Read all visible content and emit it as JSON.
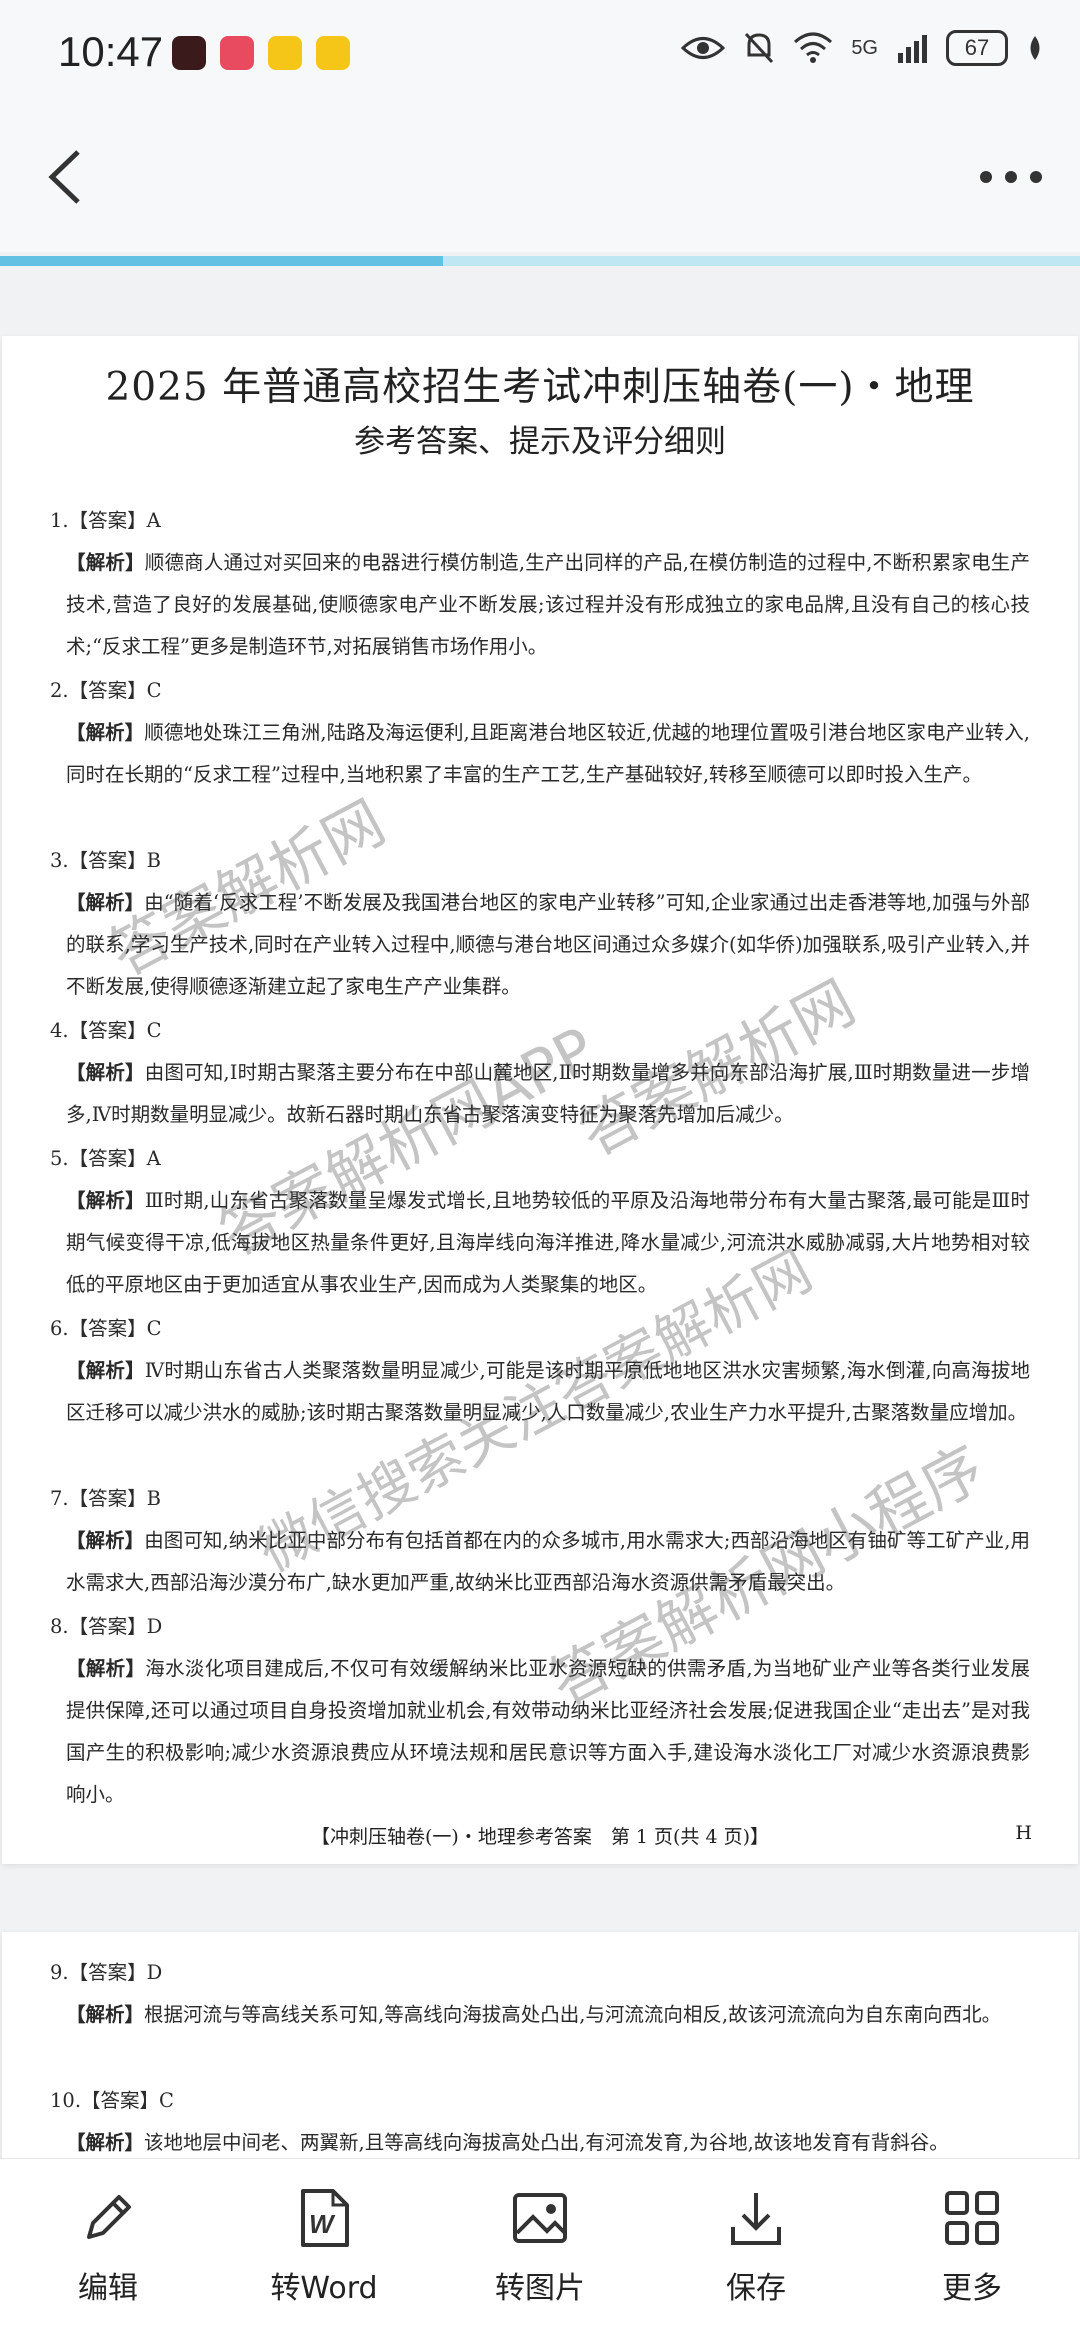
{
  "status_bar": {
    "time": "10:47",
    "network": "5G",
    "battery": "67"
  },
  "progress": {
    "value": 0.41
  },
  "doc": {
    "title": "2025 年普通高校招生考试冲刺压轴卷(一)・地理",
    "subtitle": "参考答案、提示及评分细则",
    "footer": "【冲刺压轴卷(一)・地理参考答案　第 1 页(共 4 页)】",
    "footer_mark": "H",
    "analysis_tag": "【解析】",
    "questions": [
      {
        "ans": "1.【答案】A",
        "analysis": "顺德商人通过对买回来的电器进行模仿制造,生产出同样的产品,在模仿制造的过程中,不断积累家电生产技术,营造了良好的发展基础,使顺德家电产业不断发展;该过程并没有形成独立的家电品牌,且没有自己的核心技术;“反求工程”更多是制造环节,对拓展销售市场作用小。"
      },
      {
        "ans": "2.【答案】C",
        "analysis": "顺德地处珠江三角洲,陆路及海运便利,且距离港台地区较近,优越的地理位置吸引港台地区家电产业转入,同时在长期的“反求工程”过程中,当地积累了丰富的生产工艺,生产基础较好,转移至顺德可以即时投入生产。"
      },
      {
        "ans": "3.【答案】B",
        "analysis": "由“随着‘反求工程’不断发展及我国港台地区的家电产业转移”可知,企业家通过出走香港等地,加强与外部的联系,学习生产技术,同时在产业转入过程中,顺德与港台地区间通过众多媒介(如华侨)加强联系,吸引产业转入,并不断发展,使得顺德逐渐建立起了家电生产产业集群。"
      },
      {
        "ans": "4.【答案】C",
        "analysis": "由图可知,Ⅰ时期古聚落主要分布在中部山麓地区,Ⅱ时期数量增多并向东部沿海扩展,Ⅲ时期数量进一步增多,Ⅳ时期数量明显减少。故新石器时期山东省古聚落演变特征为聚落先增加后减少。"
      },
      {
        "ans": "5.【答案】A",
        "analysis": "Ⅲ时期,山东省古聚落数量呈爆发式增长,且地势较低的平原及沿海地带分布有大量古聚落,最可能是Ⅲ时期气候变得干凉,低海拔地区热量条件更好,且海岸线向海洋推进,降水量减少,河流洪水威胁减弱,大片地势相对较低的平原地区由于更加适宜从事农业生产,因而成为人类聚集的地区。"
      },
      {
        "ans": "6.【答案】C",
        "analysis": "Ⅳ时期山东省古人类聚落数量明显减少,可能是该时期平原低地地区洪水灾害频繁,海水倒灌,向高海拔地区迁移可以减少洪水的威胁;该时期古聚落数量明显减少,人口数量减少,农业生产力水平提升,古聚落数量应增加。"
      },
      {
        "ans": "7.【答案】B",
        "analysis": "由图可知,纳米比亚中部分布有包括首都在内的众多城市,用水需求大;西部沿海地区有铀矿等工矿产业,用水需求大,西部沿海沙漠分布广,缺水更加严重,故纳米比亚西部沿海水资源供需矛盾最突出。"
      },
      {
        "ans": "8.【答案】D",
        "analysis": "海水淡化项目建成后,不仅可有效缓解纳米比亚水资源短缺的供需矛盾,为当地矿业产业等各类行业发展提供保障,还可以通过项目自身投资增加就业机会,有效带动纳米比亚经济社会发展;促进我国企业“走出去”是对我国产生的积极影响;减少水资源浪费应从环境法规和居民意识等方面入手,建设海水淡化工厂对减少水资源浪费影响小。"
      }
    ],
    "page2_questions": [
      {
        "ans": "9.【答案】D",
        "analysis": "根据河流与等高线关系可知,等高线向海拔高处凸出,与河流流向相反,故该河流流向为自东南向西北。"
      },
      {
        "ans": "10.【答案】C",
        "analysis": "该地地层中间老、两翼新,且等高线向海拔高处凸出,有河流发育,为谷地,故该地发育有背斜谷。"
      }
    ]
  },
  "watermarks": [
    "答案解析网",
    "答案解析网APP",
    "答案解析网",
    "微信搜索关注答案解析网",
    "答案解析网小程序"
  ],
  "toolbar": {
    "edit": "编辑",
    "to_word": "转Word",
    "to_image": "转图片",
    "save": "保存",
    "more": "更多"
  },
  "colors": {
    "accent": "#63c1e4",
    "track": "#bfe6f3"
  }
}
